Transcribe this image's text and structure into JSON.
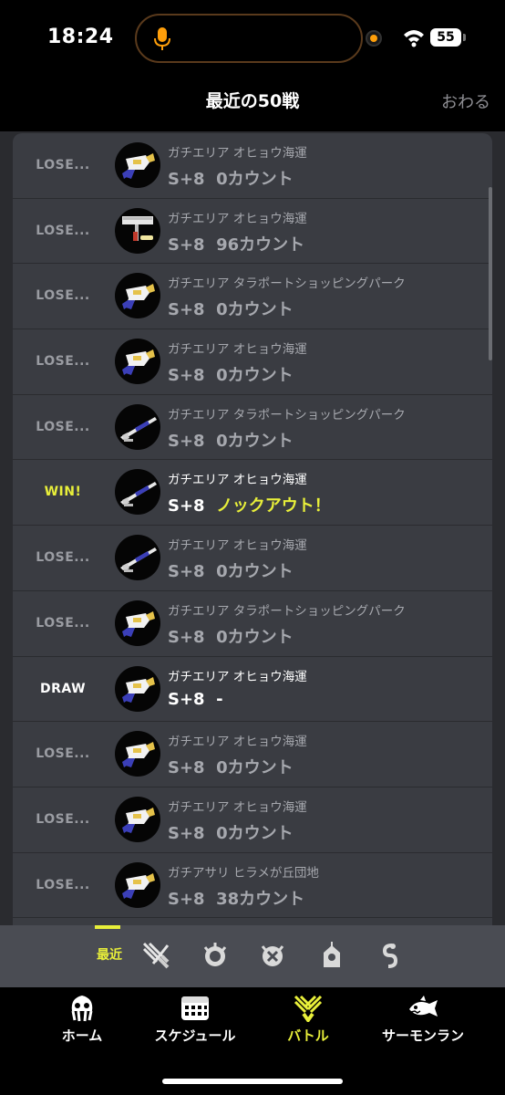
{
  "status_bar": {
    "time": "18:24",
    "battery": "55"
  },
  "header": {
    "title": "最近の50戦",
    "close_label": "おわる"
  },
  "battles": [
    {
      "result": "LOSE...",
      "result_type": "lose",
      "weapon_icon": "splattershot-icon",
      "mode_stage": "ガチエリア オヒョウ海運",
      "rank": "S+8",
      "score": "0カウント"
    },
    {
      "result": "LOSE...",
      "result_type": "lose",
      "weapon_icon": "roller-icon",
      "mode_stage": "ガチエリア オヒョウ海運",
      "rank": "S+8",
      "score": "96カウント"
    },
    {
      "result": "LOSE...",
      "result_type": "lose",
      "weapon_icon": "splattershot-icon",
      "mode_stage": "ガチエリア タラポートショッピングパーク",
      "rank": "S+8",
      "score": "0カウント"
    },
    {
      "result": "LOSE...",
      "result_type": "lose",
      "weapon_icon": "splattershot-icon",
      "mode_stage": "ガチエリア オヒョウ海運",
      "rank": "S+8",
      "score": "0カウント"
    },
    {
      "result": "LOSE...",
      "result_type": "lose",
      "weapon_icon": "charger-icon",
      "mode_stage": "ガチエリア タラポートショッピングパーク",
      "rank": "S+8",
      "score": "0カウント"
    },
    {
      "result": "WIN!",
      "result_type": "win",
      "weapon_icon": "charger-icon",
      "mode_stage": "ガチエリア オヒョウ海運",
      "rank": "S+8",
      "score": "ノックアウト！"
    },
    {
      "result": "LOSE...",
      "result_type": "lose",
      "weapon_icon": "charger-icon",
      "mode_stage": "ガチエリア オヒョウ海運",
      "rank": "S+8",
      "score": "0カウント"
    },
    {
      "result": "LOSE...",
      "result_type": "lose",
      "weapon_icon": "splattershot-icon",
      "mode_stage": "ガチエリア タラポートショッピングパーク",
      "rank": "S+8",
      "score": "0カウント"
    },
    {
      "result": "DRAW",
      "result_type": "draw",
      "weapon_icon": "splattershot-icon",
      "mode_stage": "ガチエリア オヒョウ海運",
      "rank": "S+8",
      "score": "-"
    },
    {
      "result": "LOSE...",
      "result_type": "lose",
      "weapon_icon": "splattershot-icon",
      "mode_stage": "ガチエリア オヒョウ海運",
      "rank": "S+8",
      "score": "0カウント"
    },
    {
      "result": "LOSE...",
      "result_type": "lose",
      "weapon_icon": "splattershot-icon",
      "mode_stage": "ガチエリア オヒョウ海運",
      "rank": "S+8",
      "score": "0カウント"
    },
    {
      "result": "LOSE...",
      "result_type": "lose",
      "weapon_icon": "splattershot-icon",
      "mode_stage": "ガチアサリ ヒラメが丘団地",
      "rank": "S+8",
      "score": "38カウント"
    }
  ],
  "mode_tabs": {
    "recent_label": "最近",
    "icons": [
      "regular-battle-icon",
      "ranked-battle-icon",
      "league-battle-icon",
      "private-battle-icon",
      "salmon-hook-icon"
    ]
  },
  "bottom_nav": {
    "items": [
      {
        "label": "ホーム",
        "icon": "squid-icon"
      },
      {
        "label": "スケジュール",
        "icon": "calendar-icon"
      },
      {
        "label": "バトル",
        "icon": "battle-icon",
        "active": true
      },
      {
        "label": "サーモンラン",
        "icon": "salmon-icon"
      }
    ]
  },
  "colors": {
    "accent": "#e8ef3a",
    "card": "#3a3c42",
    "muted": "#9a9ca2"
  }
}
